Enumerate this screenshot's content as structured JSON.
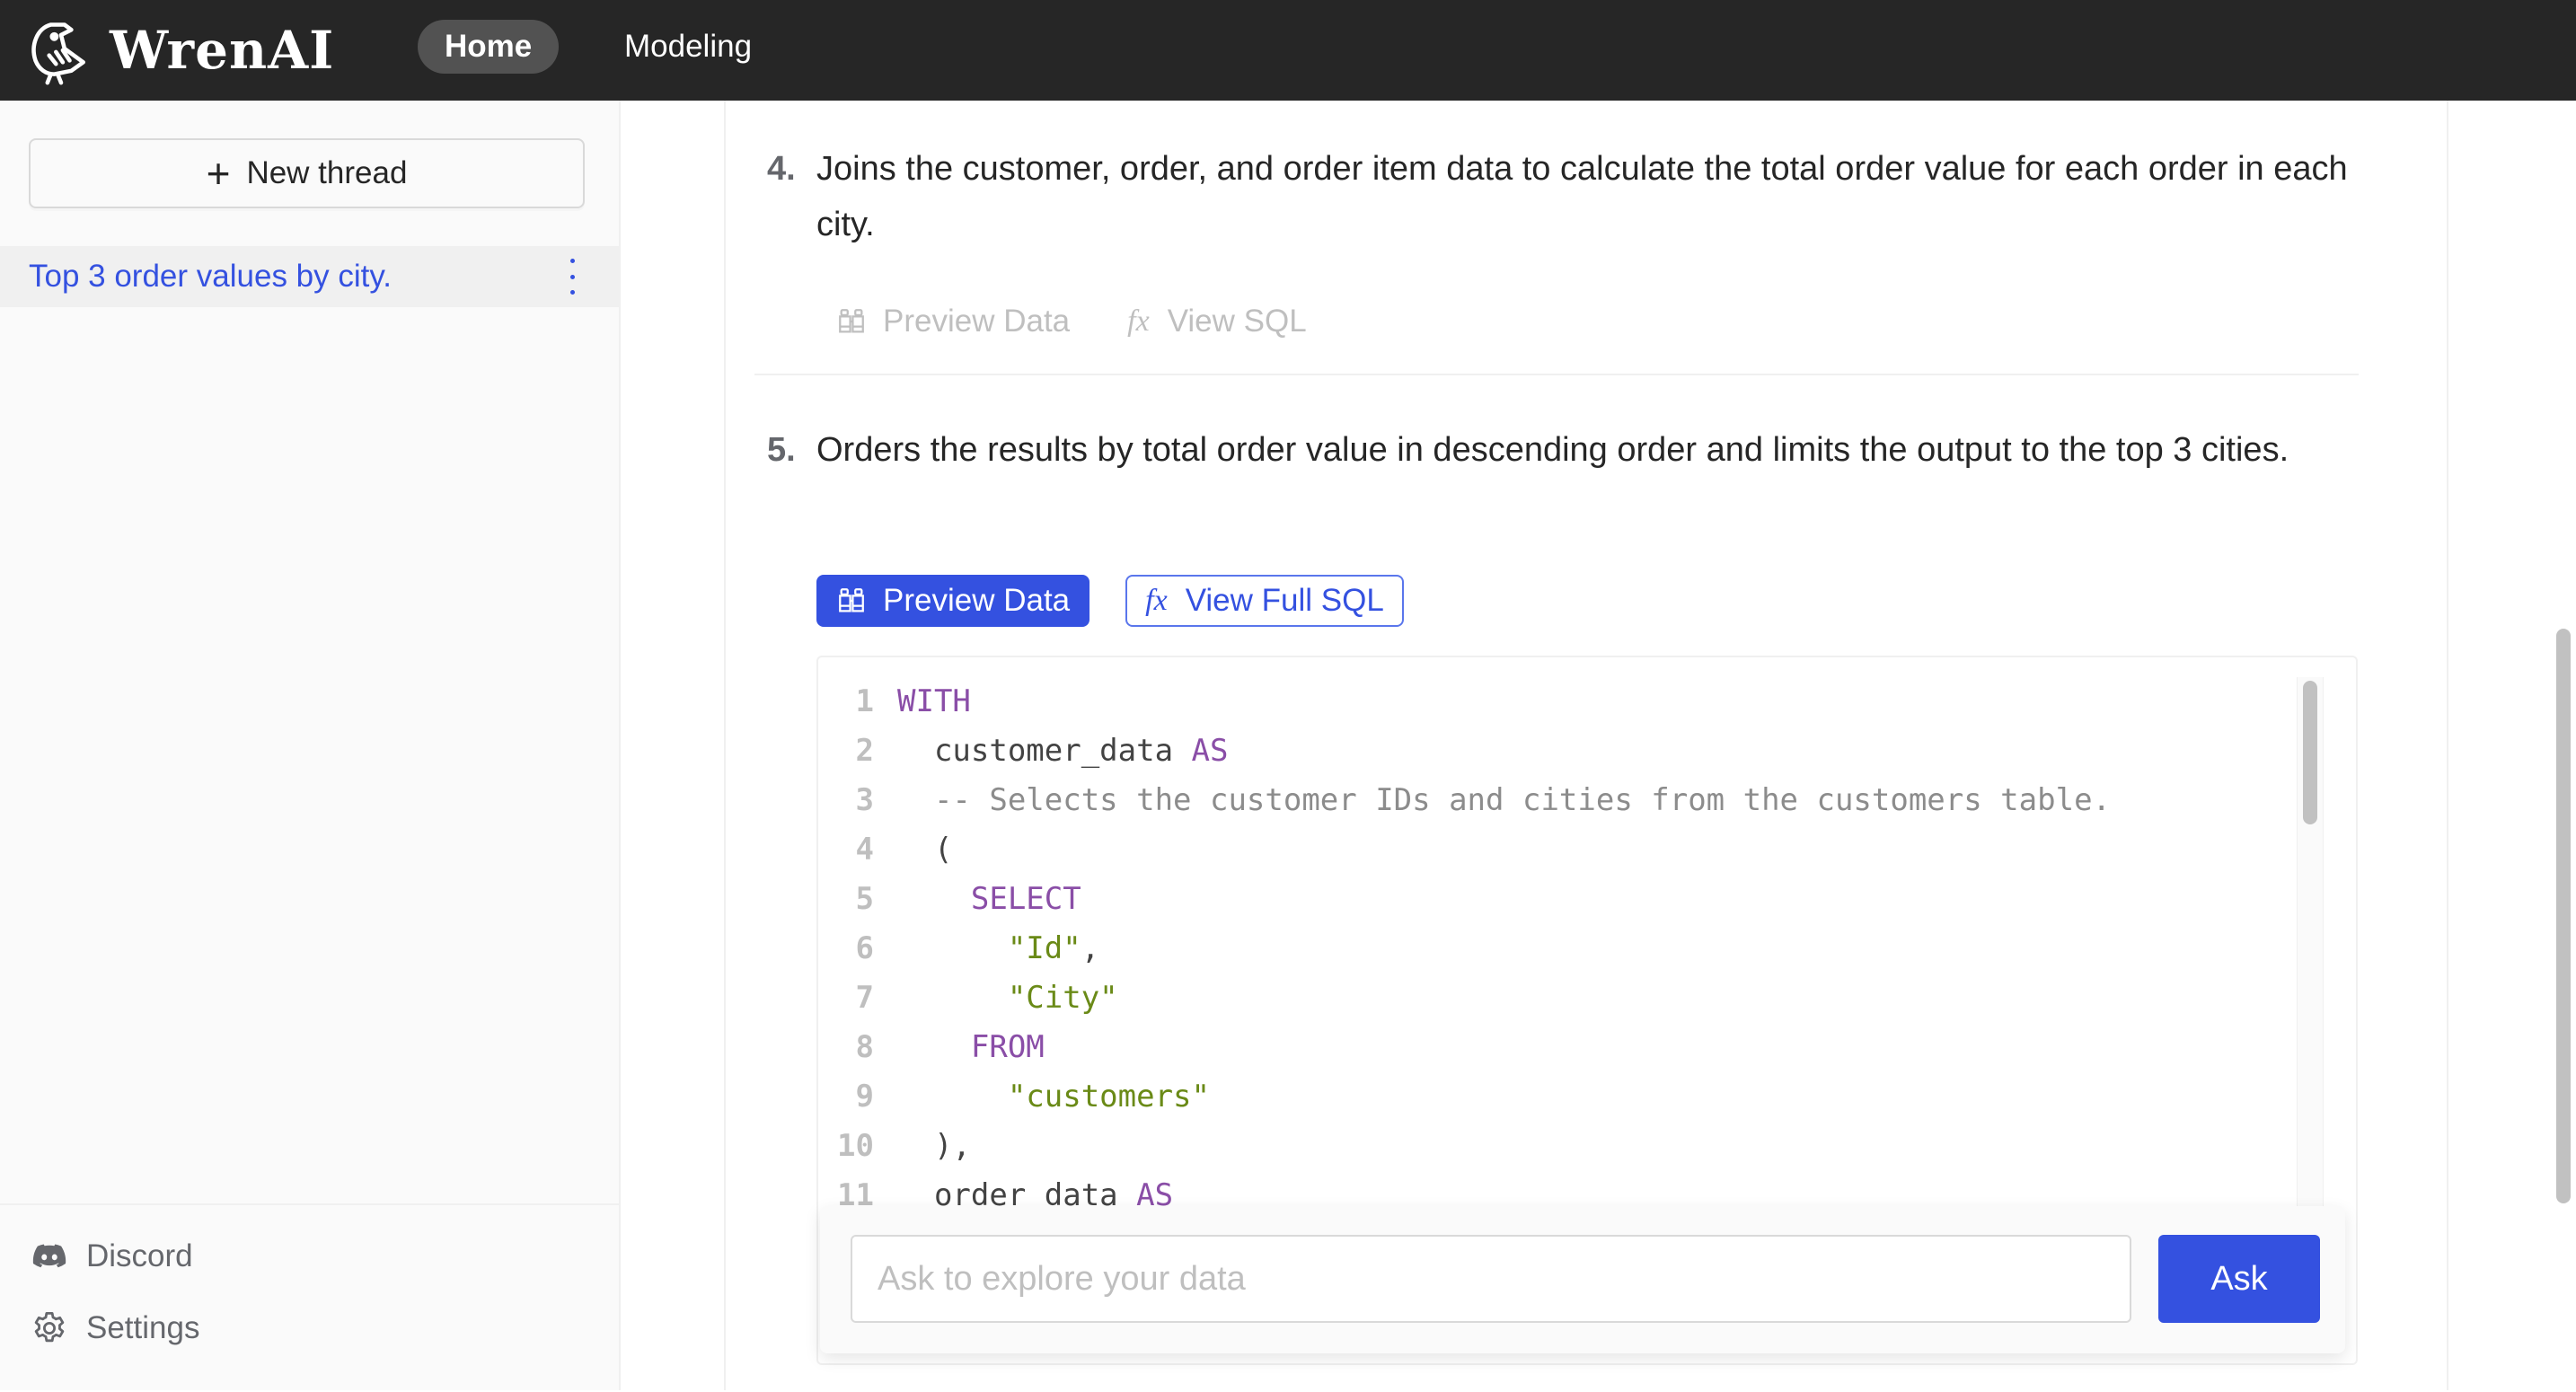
{
  "app": {
    "brand": "WrenAI",
    "nav": [
      {
        "label": "Home",
        "active": true
      },
      {
        "label": "Modeling",
        "active": false
      }
    ]
  },
  "sidebar": {
    "new_thread_label": "New thread",
    "threads": [
      {
        "label": "Top 3 order values by city.",
        "selected": true
      }
    ],
    "footer": [
      {
        "label": "Discord",
        "icon": "discord-icon"
      },
      {
        "label": "Settings",
        "icon": "gear-icon"
      }
    ]
  },
  "steps": [
    {
      "number": "4.",
      "text": "Joins the customer, order, and order item data to calculate the total order value for each order in each city.",
      "preview_label": "Preview Data",
      "sql_label": "View SQL",
      "active": false
    },
    {
      "number": "5.",
      "text": "Orders the results by total order value in descending order and limits the output to the top 3 cities.",
      "preview_label": "Preview Data",
      "sql_label": "View Full SQL",
      "active": true
    }
  ],
  "sql": {
    "lines": [
      {
        "n": "1",
        "tokens": [
          {
            "t": "WITH",
            "c": "kw"
          }
        ]
      },
      {
        "n": "2",
        "tokens": [
          {
            "t": "  customer_data ",
            "c": ""
          },
          {
            "t": "AS",
            "c": "kw"
          }
        ]
      },
      {
        "n": "3",
        "tokens": [
          {
            "t": "  -- Selects the customer IDs and cities from the customers table.",
            "c": "cm"
          }
        ]
      },
      {
        "n": "4",
        "tokens": [
          {
            "t": "  (",
            "c": ""
          }
        ]
      },
      {
        "n": "5",
        "tokens": [
          {
            "t": "    ",
            "c": ""
          },
          {
            "t": "SELECT",
            "c": "kw"
          }
        ]
      },
      {
        "n": "6",
        "tokens": [
          {
            "t": "      ",
            "c": ""
          },
          {
            "t": "\"Id\"",
            "c": "str"
          },
          {
            "t": ",",
            "c": ""
          }
        ]
      },
      {
        "n": "7",
        "tokens": [
          {
            "t": "      ",
            "c": ""
          },
          {
            "t": "\"City\"",
            "c": "str"
          }
        ]
      },
      {
        "n": "8",
        "tokens": [
          {
            "t": "    ",
            "c": ""
          },
          {
            "t": "FROM",
            "c": "kw"
          }
        ]
      },
      {
        "n": "9",
        "tokens": [
          {
            "t": "      ",
            "c": ""
          },
          {
            "t": "\"customers\"",
            "c": "str"
          }
        ]
      },
      {
        "n": "10",
        "tokens": [
          {
            "t": "  ),",
            "c": ""
          }
        ]
      },
      {
        "n": "11",
        "tokens": [
          {
            "t": "  order_data ",
            "c": ""
          },
          {
            "t": "AS",
            "c": "kw"
          }
        ]
      }
    ]
  },
  "ask": {
    "placeholder": "Ask to explore your data",
    "value": "",
    "button_label": "Ask"
  },
  "colors": {
    "brand_blue": "#3451e0",
    "navbar_bg": "#262626",
    "keyword": "#8a4ea7",
    "string": "#6a8a17",
    "comment": "#8c8c8c"
  }
}
